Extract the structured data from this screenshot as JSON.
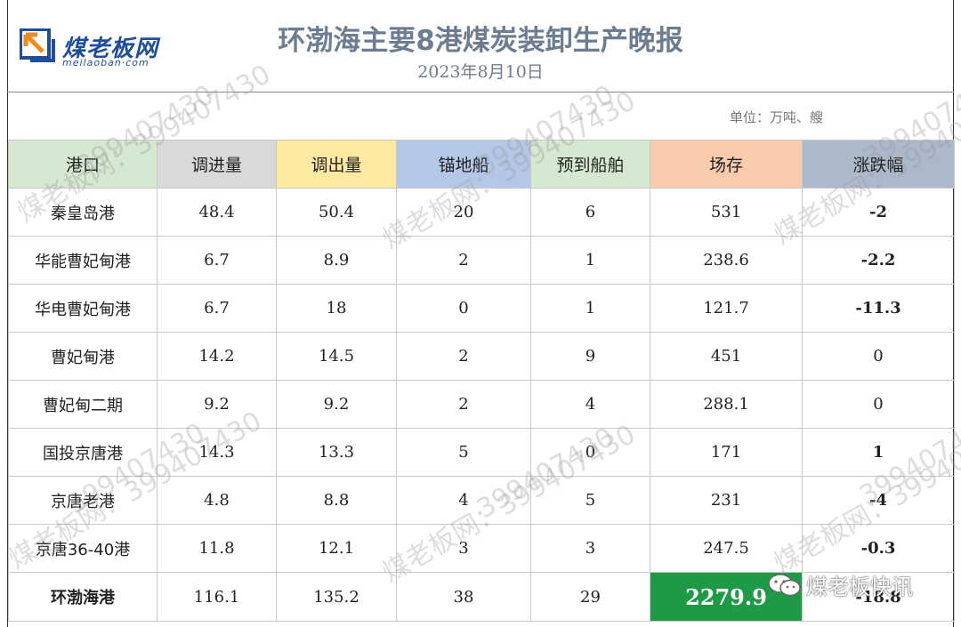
{
  "header": {
    "brand_name": "煤老板网",
    "brand_domain": "meilaoban·com",
    "title": "环渤海主要8港煤炭装卸生产晚报",
    "date": "2023年8月10日",
    "unit": "单位：万吨、艘"
  },
  "table": {
    "columns": [
      "港口",
      "调进量",
      "调出量",
      "锚地船",
      "预到船舶",
      "场存",
      "涨跌幅"
    ],
    "column_colors": [
      "#d5e8d0",
      "#d9d9d9",
      "#fde9a0",
      "#b4c7e7",
      "#d5e8d0",
      "#f8cbad",
      "#acb9ca"
    ],
    "rows": [
      {
        "port": "秦皇岛港",
        "in": "48.4",
        "out": "50.4",
        "anchor": "20",
        "expected": "6",
        "stock": "531",
        "change": "-2",
        "dir": "neg"
      },
      {
        "port": "华能曹妃甸港",
        "in": "6.7",
        "out": "8.9",
        "anchor": "2",
        "expected": "1",
        "stock": "238.6",
        "change": "-2.2",
        "dir": "neg"
      },
      {
        "port": "华电曹妃甸港",
        "in": "6.7",
        "out": "18",
        "anchor": "0",
        "expected": "1",
        "stock": "121.7",
        "change": "-11.3",
        "dir": "neg"
      },
      {
        "port": "曹妃甸港",
        "in": "14.2",
        "out": "14.5",
        "anchor": "2",
        "expected": "9",
        "stock": "451",
        "change": "0",
        "dir": "zero"
      },
      {
        "port": "曹妃甸二期",
        "in": "9.2",
        "out": "9.2",
        "anchor": "2",
        "expected": "4",
        "stock": "288.1",
        "change": "0",
        "dir": "zero"
      },
      {
        "port": "国投京唐港",
        "in": "14.3",
        "out": "13.3",
        "anchor": "5",
        "expected": "0",
        "stock": "171",
        "change": "1",
        "dir": "pos"
      },
      {
        "port": "京唐老港",
        "in": "4.8",
        "out": "8.8",
        "anchor": "4",
        "expected": "5",
        "stock": "231",
        "change": "-4",
        "dir": "neg"
      },
      {
        "port": "京唐36-40港",
        "in": "11.8",
        "out": "12.1",
        "anchor": "3",
        "expected": "3",
        "stock": "247.5",
        "change": "-0.3",
        "dir": "neg"
      }
    ],
    "total": {
      "port": "环渤海港",
      "in": "116.1",
      "out": "135.2",
      "anchor": "38",
      "expected": "29",
      "stock": "2279.9",
      "change": "-18.8",
      "dir": "neg"
    }
  },
  "watermark": {
    "id_text": "399407430",
    "site_text": "煤老板网：399407430"
  },
  "footer_badge": {
    "icon": "wechat-icon",
    "label": "煤老板快讯"
  },
  "colors": {
    "negative": "#1e9a47",
    "positive": "#e41f1f",
    "stock_highlight": "#1e9a47",
    "title": "#6d7d91",
    "brand": "#1f4e9c"
  }
}
